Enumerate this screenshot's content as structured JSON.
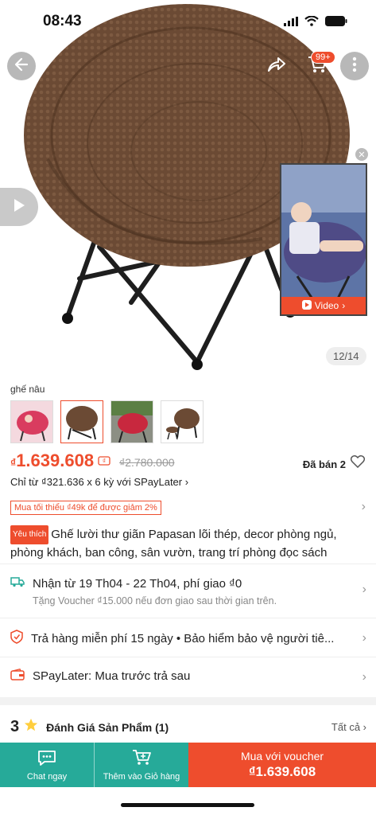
{
  "status_bar": {
    "time": "08:43"
  },
  "header": {
    "cart_count": "99+",
    "image_counter": "12/14",
    "video_label": "Video"
  },
  "variants": {
    "title": "ghế nâu",
    "count": 4
  },
  "price": {
    "currency": "₫",
    "current": "1.639.608",
    "original": "₫2.780.000",
    "sold": "Đã bán 2",
    "installment": "Chỉ từ ₫321.636 x 6 kỳ với SPayLater"
  },
  "promo": {
    "text": "Mua tối thiểu ₫49k để được giảm 2%"
  },
  "product": {
    "tag": "Yêu thích",
    "title": "Ghế lười thư giãn Papasan lõi thép, decor phòng ngủ, phòng khách, ban công, sân vườn, trang trí phòng đọc sách"
  },
  "shipping": {
    "main": "Nhận từ 19 Th04 - 22 Th04, phí giao ₫0",
    "sub": "Tặng Voucher ₫15.000 nếu đơn giao sau thời gian trên."
  },
  "returns": {
    "text": "Trả hàng miễn phí 15 ngày  •  Bảo hiểm bảo vệ người tiê..."
  },
  "spaylater": {
    "text": "SPayLater: Mua trước trả sau"
  },
  "review": {
    "score": "3",
    "title": "Đánh Giá Sản Phẩm",
    "count": "(1)",
    "see_all": "Tất cả"
  },
  "bottom_bar": {
    "chat": "Chat ngay",
    "add_cart": "Thêm vào Giỏ hàng",
    "buy_label": "Mua với voucher",
    "buy_price": "₫1.639.608"
  },
  "colors": {
    "accent": "#ee4d2d",
    "teal": "#26aa99",
    "chair_brown": "#6b4a34"
  }
}
